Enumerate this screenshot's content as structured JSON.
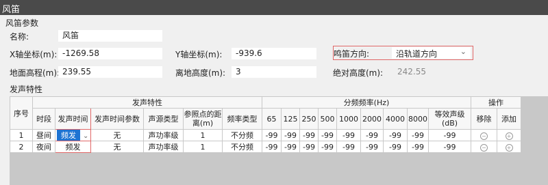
{
  "window": {
    "title": "风笛"
  },
  "params": {
    "section_title": "风笛参数",
    "name_label": "名称:",
    "name_value": "风笛",
    "x_label": "X轴坐标(m):",
    "x_value": "-1269.58",
    "y_label": "Y轴坐标(m):",
    "y_value": "-939.6",
    "direction_label": "鸣笛方向:",
    "direction_value": "沿轨道方向",
    "ground_label": "地面高程(m):",
    "ground_value": "239.55",
    "height_label": "离地高度(m):",
    "height_value": "3",
    "abs_label": "绝对高度(m):",
    "abs_value": "242.55"
  },
  "sound": {
    "section_title": "发声特性",
    "headers": {
      "index": "序号",
      "group": "发声特性",
      "period": "时段",
      "time": "发声时间",
      "time_param": "发声时间参数",
      "source_type": "声源类型",
      "ref_distance": "参照点的距离(m)",
      "freq_type": "频率类型",
      "freq_group": "分频频率(Hz)",
      "freqs": [
        "65",
        "125",
        "250",
        "500",
        "1000",
        "2000",
        "4000",
        "8000"
      ],
      "equiv": "等效声级(dB)",
      "op_group": "操作",
      "remove": "移除",
      "add": "添加"
    },
    "rows": [
      {
        "index": "1",
        "period": "昼间",
        "time": "频发",
        "time_param": "无",
        "source_type": "声功率级",
        "ref_distance": "1",
        "freq_type": "不分频",
        "bands": [
          "-99",
          "-99",
          "-99",
          "-99",
          "-99",
          "-99",
          "-99",
          "-99"
        ],
        "equiv": "-99"
      },
      {
        "index": "2",
        "period": "夜间",
        "time": "频发",
        "time_param": "无",
        "source_type": "声功率级",
        "ref_distance": "1",
        "freq_type": "不分频",
        "bands": [
          "-99",
          "-99",
          "-99",
          "-99",
          "-99",
          "-99",
          "-99",
          "-99"
        ],
        "equiv": "-99"
      }
    ]
  },
  "colors": {
    "titlebar": "#4a4a4a",
    "selected": "#1e73d2",
    "focus_border": "#e06666"
  },
  "icons": {
    "remove": "minus-circle-icon",
    "add": "plus-circle-icon",
    "dropdown": "chevron-down-icon"
  }
}
